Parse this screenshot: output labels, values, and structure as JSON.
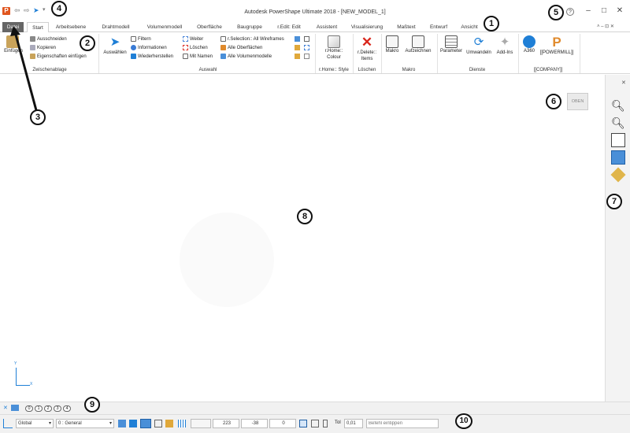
{
  "window": {
    "title": "Autodesk PowerShape Ultimate 2018 - [NEW_MODEL_1]",
    "help_glyph": "?",
    "minimize": "–",
    "maximize": "□",
    "close": "✕",
    "mdi_controls": "˄ ‒ ⊡ ✕"
  },
  "tabs": [
    "Datei",
    "Start",
    "Arbeitsebene",
    "Drahtmodell",
    "Volumenmodell",
    "Oberfläche",
    "Baugruppe",
    "r.Edit: Edit",
    "Assistent",
    "Visualisierung",
    "Maßtext",
    "Entwurf",
    "Ansicht"
  ],
  "ribbon": {
    "clipboard": {
      "paste": "Einfügen",
      "cut": "Ausschneiden",
      "copy": "Kopieren",
      "paste_props": "Eigenschaften einfügen",
      "label": "Zwischenablage"
    },
    "select": {
      "select_btn": "Auswählen",
      "filter": "Filtern",
      "info": "Informationen",
      "restore": "Wiederherstellen",
      "next": "Weiter",
      "delete": "Löschen",
      "by_name": "Mit Namen",
      "rsel": "r.Selection:: All Wireframes",
      "all_surfaces": "Alle Oberflächen",
      "all_solids": "Alle Volumenmodelle",
      "label": "Auswahl"
    },
    "style": {
      "btn": "r.Home:: Colour",
      "label": "r.Home:: Style"
    },
    "delete": {
      "btn": "r.Delete:: Items",
      "label": "Löschen"
    },
    "macro": {
      "macro": "Makro",
      "record": "Aufzeichnen",
      "label": "Makro"
    },
    "services": {
      "params": "Parameter",
      "convert": "Umwandeln",
      "addins": "Add-Ins",
      "label": "Dienste"
    },
    "company": {
      "a360": "A360",
      "powermill": "[[POWERMILL]]",
      "label": "[[COMPANY]]"
    }
  },
  "viewcube": {
    "label": "OBEN"
  },
  "axis": {
    "y": "Y",
    "x": "X"
  },
  "levels": [
    "0",
    "1",
    "2",
    "3",
    "4"
  ],
  "status": {
    "workplane": "Global",
    "level": "0 : General",
    "x": "223",
    "y": "-38",
    "z": "0",
    "tol_label": "Tol",
    "tol_value": "0,01",
    "command_placeholder": "Befehl eintippen"
  },
  "callouts": [
    "1",
    "2",
    "3",
    "4",
    "5",
    "6",
    "7",
    "8",
    "9",
    "10"
  ],
  "colors": {
    "accent": "#e0561f",
    "tab_active_bg": "#ffffff",
    "datei_bg": "#666666",
    "blue": "#1f7fd6",
    "red": "#d9261c"
  }
}
